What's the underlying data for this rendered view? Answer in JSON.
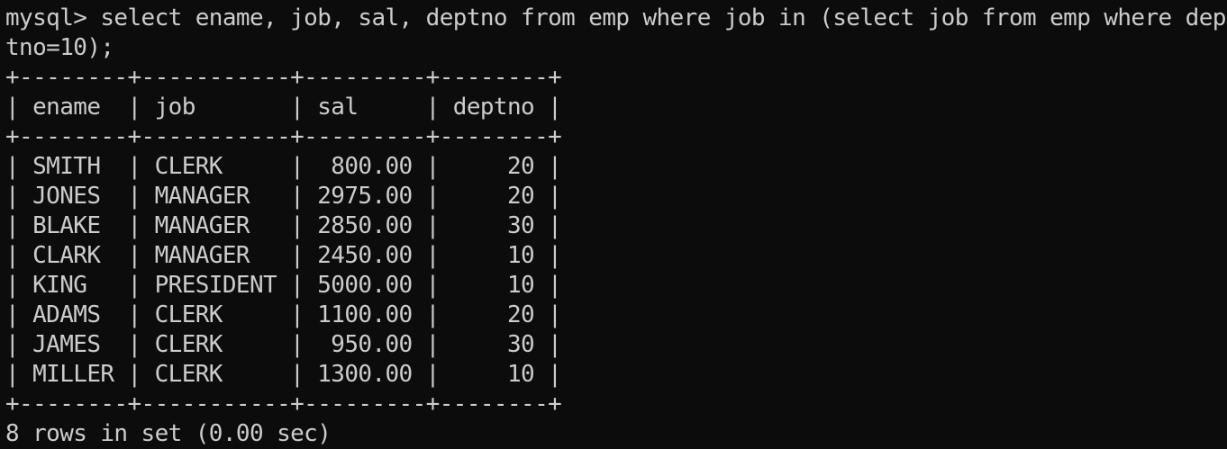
{
  "terminal": {
    "command_line_1": "mysql> select ename, job, sal, deptno from emp where job in (select job from emp where dep",
    "command_line_2": "tno=10);",
    "border": "+--------+-----------+---------+--------+",
    "header": "| ename  | job       | sal     | deptno |",
    "rows": [
      "| SMITH  | CLERK     |  800.00 |     20 |",
      "| JONES  | MANAGER   | 2975.00 |     20 |",
      "| BLAKE  | MANAGER   | 2850.00 |     30 |",
      "| CLARK  | MANAGER   | 2450.00 |     10 |",
      "| KING   | PRESIDENT | 5000.00 |     10 |",
      "| ADAMS  | CLERK     | 1100.00 |     20 |",
      "| JAMES  | CLERK     |  950.00 |     30 |",
      "| MILLER | CLERK     | 1300.00 |     10 |"
    ],
    "table": {
      "columns": [
        "ename",
        "job",
        "sal",
        "deptno"
      ],
      "records": [
        [
          "SMITH",
          "CLERK",
          "800.00",
          "20"
        ],
        [
          "JONES",
          "MANAGER",
          "2975.00",
          "20"
        ],
        [
          "BLAKE",
          "MANAGER",
          "2850.00",
          "30"
        ],
        [
          "CLARK",
          "MANAGER",
          "2450.00",
          "10"
        ],
        [
          "KING",
          "PRESIDENT",
          "5000.00",
          "10"
        ],
        [
          "ADAMS",
          "CLERK",
          "1100.00",
          "20"
        ],
        [
          "JAMES",
          "CLERK",
          "950.00",
          "30"
        ],
        [
          "MILLER",
          "CLERK",
          "1300.00",
          "10"
        ]
      ]
    },
    "result_summary": "8 rows in set (0.00 sec)"
  }
}
